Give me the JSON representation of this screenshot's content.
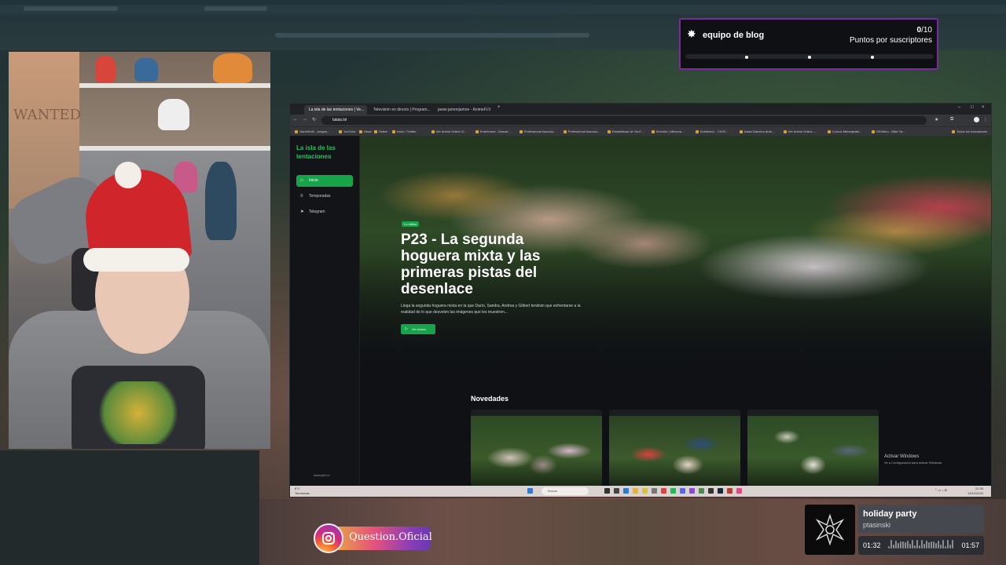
{
  "overlay": {
    "subs_widget": {
      "title": "equipo de blog",
      "count": "0",
      "goal": "/10",
      "label": "Puntos por suscriptores",
      "progress": 0
    },
    "music": {
      "title": "holiday party",
      "artist": "ptasinski",
      "elapsed": "01:32",
      "duration": "01:57"
    },
    "instagram": {
      "handle": "Question.Oficial"
    }
  },
  "browser": {
    "tabs": [
      {
        "label": "La isla de las tentaciones | Ve..."
      },
      {
        "label": "Televisión en directo | Program..."
      },
      {
        "label": "javier.jamonjamon - AnimeFLV"
      }
    ],
    "url": "lataia.lol",
    "bookmarks": [
      "GameKnill - Juegos...",
      "YouTube",
      "Maze",
      "Twitch",
      "Inicio / Twitter",
      "Ver Anime Online G...",
      "Entertment - Descar...",
      "Professional Associa...",
      "Professional Associa...",
      "Estadisticas de YouT...",
      "Servidor | Minecra...",
      "Solutions1 - CIVIV...",
      "Asian Dancers Ante...",
      "Ver Anime Online -...",
      "Cursos Mensajeabl...",
      "OSVideo - Mike Ya..."
    ],
    "all_bookmarks": "Todos los marcadores"
  },
  "site": {
    "title": "La isla de las tentaciones",
    "nav": [
      {
        "label": "Inicio",
        "icon": "home-icon",
        "active": true
      },
      {
        "label": "Temporadas",
        "icon": "list-icon",
        "active": false
      },
      {
        "label": "Telegram",
        "icon": "send-icon",
        "active": false
      }
    ],
    "footer": "lataia@lol.e",
    "hero": {
      "badge": "Lo último",
      "title": "P23 - La segunda hoguera mixta y las primeras pistas del desenlace",
      "description": "Llega la segunda hoguera mixta en la que Darío, Sandra, Andrea y Gilbert tendrán que enfrentarse a la realidad de lo que desvelen las imágenes que les muestren...",
      "button": "Ver Ahora"
    },
    "section_title": "Novedades",
    "cards": 3
  },
  "windows": {
    "activate_title": "Activar Windows",
    "activate_sub": "Ve a Configuración para activar Windows.",
    "weather_temp": "8°C",
    "weather_desc": "Tormentas",
    "search": "Buscar",
    "time": "22:30",
    "date": "19/12/2023"
  },
  "colors": {
    "accent": "#16a34a",
    "widget_border": "#7a2c9a"
  }
}
